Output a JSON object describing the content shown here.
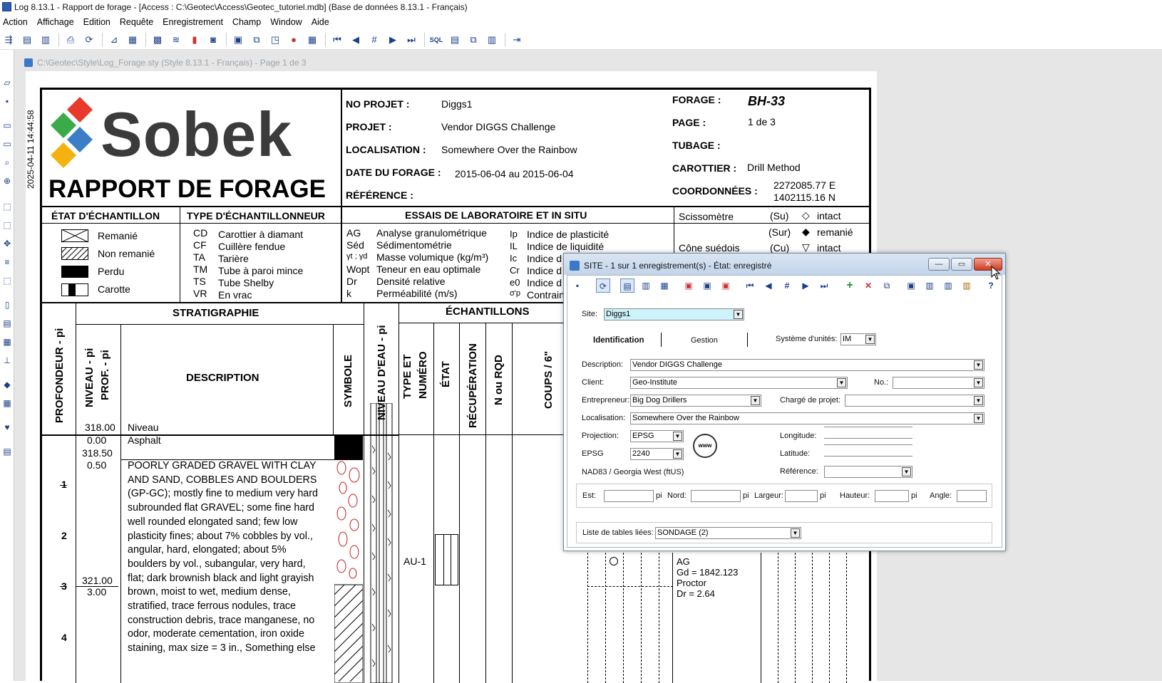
{
  "window": {
    "title": "Log 8.13.1 - Rapport de forage - [Access : C:\\Geotec\\Access\\Geotec_tutoriel.mdb] (Base de données 8.13.1 - Français)"
  },
  "menu": [
    "Action",
    "Affichage",
    "Edition",
    "Requête",
    "Enregistrement",
    "Champ",
    "Window",
    "Aide"
  ],
  "toolbar": {
    "sql": "SQL"
  },
  "document": {
    "title": "C:\\Geotec\\Style\\Log_Forage.sty (Style 8.13.1 - Français) - Page 1 de 3",
    "datestamp": "2025-04-11 14:44:58"
  },
  "report": {
    "logo_text": "Sobek",
    "heading": "RAPPORT DE FORAGE",
    "no_projet_label": "NO PROJET :",
    "no_projet": "Diggs1",
    "projet_label": "PROJET :",
    "projet": "Vendor DIGGS Challenge",
    "localisation_label": "LOCALISATION :",
    "localisation": "Somewhere Over the Rainbow",
    "date_label": "DATE DU FORAGE :",
    "date": "2015-06-04 au 2015-06-04",
    "reference_label": "RÉFÉRENCE :",
    "forage_label": "FORAGE :",
    "forage": "BH-33",
    "page_label": "PAGE :",
    "page": "1 de 3",
    "tubage_label": "TUBAGE :",
    "carottier_label": "CAROTTIER :",
    "carottier": "Drill Method",
    "coord_label": "COORDONNÉES :",
    "coord_e": "2272085.77  E",
    "coord_n": "1402115.16  N"
  },
  "legend": {
    "etat_title": "ÉTAT D'ÉCHANTILLON",
    "etat": [
      "Remanié",
      "Non remanié",
      "Perdu",
      "Carotte"
    ],
    "type_title": "TYPE D'ÉCHANTILLONNEUR",
    "type_codes": [
      "CD",
      "CF",
      "TA",
      "TM",
      "TS",
      "VR"
    ],
    "type_labels": [
      "Carottier à diamant",
      "Cuillère fendue",
      "Tarière",
      "Tube à paroi mince",
      "Tube Shelby",
      "En vrac"
    ],
    "essais_title": "ESSAIS DE LABORATOIRE ET IN SITU",
    "essais_codes": [
      "AG",
      "Séd",
      "γt ; γd",
      "Wopt",
      "Dr",
      "k"
    ],
    "essais_labels": [
      "Analyse granulométrique",
      "Sédimentométrie",
      "Masse volumique (kg/m³)",
      "Teneur en eau optimale",
      "Densité relative",
      "Perméabilité (m/s)"
    ],
    "essais2_codes": [
      "Ip",
      "IL",
      "Ic",
      "Cr",
      "e0",
      "σ'p"
    ],
    "essais2_labels": [
      "Indice de plasticité",
      "Indice de liquidité",
      "Indice d",
      "Indice d",
      "Indice d",
      "Contrain"
    ],
    "scisso": "Scissomètre",
    "cone": "Cône suédois",
    "su": "(Su)",
    "sur": "(Sur)",
    "cu": "(Cu)",
    "intact": "intact",
    "remanie": "remanié",
    "intact2": "intact"
  },
  "columns": {
    "profondeur": "PROFONDEUR - pi",
    "stratigraphie": "STRATIGRAPHIE",
    "niveau": "NIVEAU - pi",
    "prof": "PROF. - pi",
    "description": "DESCRIPTION",
    "symbole": "SYMBOLE",
    "niveau_eau": "NIVEAU D'EAU - pi",
    "echantillons": "ÉCHANTILLONS",
    "type_numero": "TYPE ET NUMÉRO",
    "etat": "ÉTAT",
    "recuperation": "RÉCUPÉRATION",
    "rqd": "N ou RQD",
    "coups": "COUPS / 6\""
  },
  "log": {
    "niveau_top": "318.00",
    "niveau_label": "Niveau",
    "d1": "0.00",
    "d1_desc": "Asphalt",
    "d2a": "318.50",
    "d2b": "0.50",
    "d3a": "321.00",
    "d3b": "3.00",
    "depth_ticks": [
      "1",
      "2",
      "3",
      "4"
    ],
    "sample": "AU-1",
    "desc_lines": [
      "POORLY GRADED GRAVEL WITH CLAY",
      "AND SAND, COBBLES AND BOULDERS",
      "(GP-GC); mostly fine to medium very hard",
      "subrounded flat GRAVEL; some fine hard",
      "well rounded elongated sand; few low",
      "plasticity fines; about 7% cobbles by vol.,",
      "angular, hard, elongated; about 5%",
      "boulders by vol., subangular, very hard,",
      "flat; dark brownish black and light grayish",
      "brown, moist to wet, medium dense,",
      "stratified, trace ferrous nodules, trace",
      "construction debris, trace manganese, no",
      "odor, moderate cementation, iron oxide",
      "staining, max size = 3 in., Something else"
    ],
    "tests": [
      "AG",
      "Gd = 1842.123",
      "Proctor",
      "Dr = 2.64"
    ]
  },
  "dialog": {
    "title": "SITE - 1 sur 1 enregistrement(s) - État: enregistré",
    "site_label": "Site:",
    "site": "Diggs1",
    "tab1": "Identification",
    "tab2": "Gestion",
    "units_label": "Système d'unités:",
    "units": "IM",
    "desc_label": "Description:",
    "desc": "Vendor DIGGS Challenge",
    "client_label": "Client:",
    "client": "Geo-Institute",
    "no_label": "No.:",
    "entrepreneur_label": "Entrepreneur:",
    "entrepreneur": "Big Dog Drillers",
    "charge_label": "Chargé de projet:",
    "localisation_label": "Localisation:",
    "localisation": "Somewhere Over the Rainbow",
    "projection_label": "Projection:",
    "projection": "EPSG",
    "epsg_label": "EPSG",
    "epsg": "2240",
    "nad": "NAD83 / Georgia West (ftUS)",
    "longitude_label": "Longitude:",
    "latitude_label": "Latitude:",
    "reference_label": "Référence:",
    "est_label": "Est:",
    "nord_label": "Nord:",
    "largeur_label": "Largeur:",
    "hauteur_label": "Hauteur:",
    "angle_label": "Angle:",
    "pi": "pi",
    "tables_label": "Liste de tables liées:",
    "tables": "SONDAGE (2)"
  }
}
